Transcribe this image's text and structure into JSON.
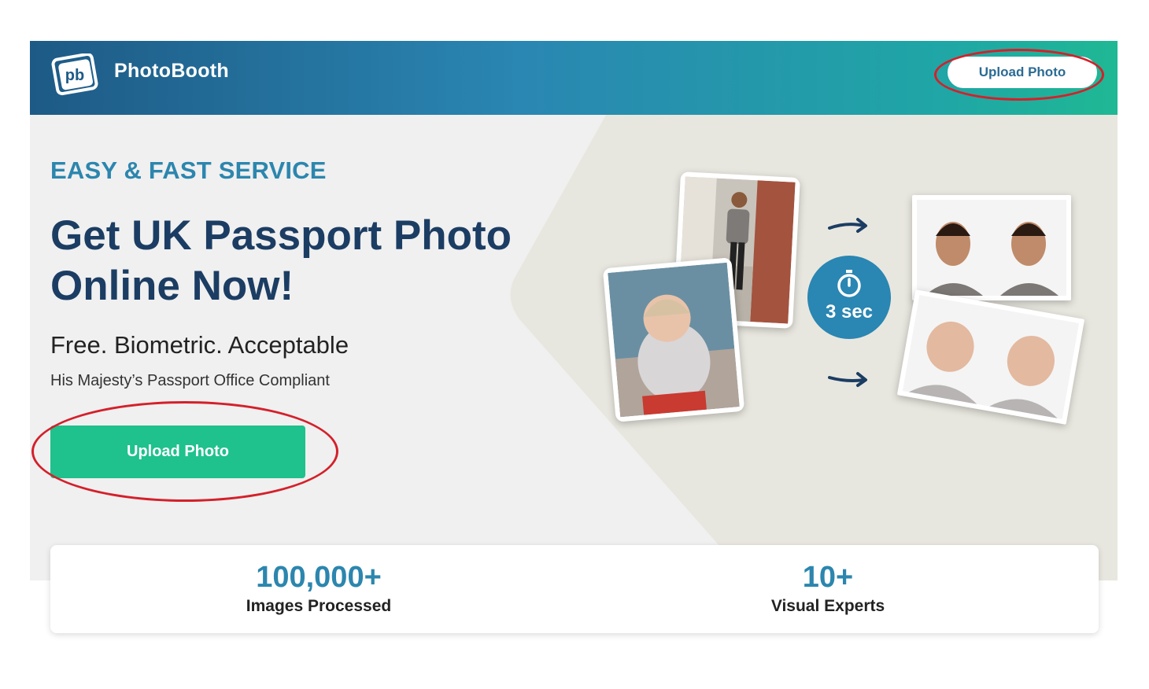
{
  "header": {
    "brand": "PhotoBooth",
    "logo_text": "pb",
    "upload_label": "Upload Photo"
  },
  "hero": {
    "eyebrow": "EASY & FAST SERVICE",
    "headline_line1": "Get UK Passport Photo",
    "headline_line2": "Online Now!",
    "subhead": "Free. Biometric. Acceptable",
    "compliance": "His Majesty’s Passport Office Compliant",
    "upload_label": "Upload Photo",
    "timer_label": "3 sec"
  },
  "stats": [
    {
      "value": "100,000+",
      "label": "Images Processed"
    },
    {
      "value": "10+",
      "label": "Visual Experts"
    }
  ],
  "colors": {
    "header_start": "#1e5a86",
    "header_end": "#1fb894",
    "accent_blue": "#2c86ae",
    "heading_navy": "#1c3d63",
    "cta_green": "#1fc18c",
    "annotation_red": "#d4202a"
  },
  "icons": [
    "photobooth-logo-icon",
    "stopwatch-icon",
    "arrow-right-icon"
  ]
}
